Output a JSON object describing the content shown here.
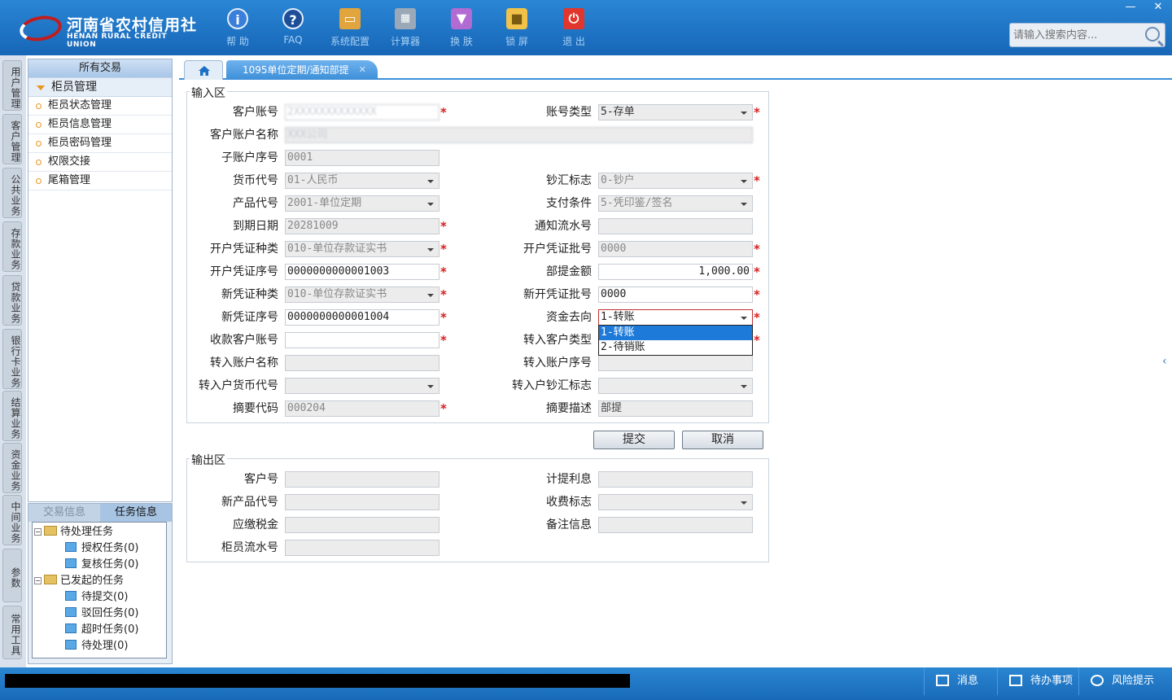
{
  "header": {
    "brand_cn": "河南省农村信用社",
    "brand_en": "HENAN RURAL CREDIT UNION",
    "buttons": [
      {
        "label": "帮 助",
        "icon": "info-icon"
      },
      {
        "label": "FAQ",
        "icon": "question-icon"
      },
      {
        "label": "系统配置",
        "icon": "toolbox-icon"
      },
      {
        "label": "计算器",
        "icon": "calculator-icon"
      },
      {
        "label": "换 肤",
        "icon": "shirt-icon"
      },
      {
        "label": "锁 屏",
        "icon": "lock-icon"
      },
      {
        "label": "退 出",
        "icon": "power-icon"
      }
    ],
    "window_controls": [
      "—",
      "✕"
    ],
    "search_placeholder": "请输入搜索内容..."
  },
  "vtabs": [
    "用户管理",
    "客户管理",
    "公共业务",
    "存款业务",
    "贷款业务",
    "银行卡业务",
    "结算业务",
    "资金业务",
    "中间业务",
    "参数",
    "常用工具"
  ],
  "nav": {
    "header": "所有交易",
    "group": "柜员管理",
    "items": [
      "柜员状态管理",
      "柜员信息管理",
      "柜员密码管理",
      "权限交接",
      "尾箱管理"
    ]
  },
  "task": {
    "tab_inactive": "交易信息",
    "tab_active": "任务信息",
    "tree": [
      {
        "label": "待处理任务",
        "type": "folder",
        "level": 0
      },
      {
        "label": "授权任务(0)",
        "type": "leaf",
        "level": 1
      },
      {
        "label": "复核任务(0)",
        "type": "leaf",
        "level": 1
      },
      {
        "label": "已发起的任务",
        "type": "folder",
        "level": 0
      },
      {
        "label": "待提交(0)",
        "type": "leaf",
        "level": 1
      },
      {
        "label": "驳回任务(0)",
        "type": "leaf",
        "level": 1
      },
      {
        "label": "超时任务(0)",
        "type": "leaf",
        "level": 1
      },
      {
        "label": "待处理(0)",
        "type": "leaf",
        "level": 1
      }
    ]
  },
  "tabs": {
    "active": "1095单位定期/通知部提",
    "close": "✕"
  },
  "input_section": {
    "title": "输入区",
    "fields": {
      "cust_account_label": "客户账号",
      "cust_account_value": "2XXXXXXXXXXXXX",
      "account_type_label": "账号类型",
      "account_type_value": "5-存单",
      "cust_name_label": "客户账户名称",
      "cust_name_value": "XXX公司",
      "sub_seq_label": "子账户序号",
      "sub_seq_value": "0001",
      "currency_label": "货币代号",
      "currency_value": "01-人民币",
      "cash_flag_label": "钞汇标志",
      "cash_flag_value": "0-钞户",
      "product_label": "产品代号",
      "product_value": "2001-单位定期",
      "pay_cond_label": "支付条件",
      "pay_cond_value": "5-凭印鉴/签名",
      "due_date_label": "到期日期",
      "due_date_value": "20281009",
      "notice_seq_label": "通知流水号",
      "notice_seq_value": "",
      "open_vtype_label": "开户凭证种类",
      "open_vtype_value": "010-单位存款证实书",
      "open_vbatch_label": "开户凭证批号",
      "open_vbatch_value": "0000",
      "open_vseq_label": "开户凭证序号",
      "open_vseq_value": "0000000000001003",
      "partial_amt_label": "部提金额",
      "partial_amt_value": "1,000.00",
      "new_vtype_label": "新凭证种类",
      "new_vtype_value": "010-单位存款证实书",
      "new_vbatch_label": "新开凭证批号",
      "new_vbatch_value": "0000",
      "new_vseq_label": "新凭证序号",
      "new_vseq_value": "0000000000001004",
      "fund_dir_label": "资金去向",
      "fund_dir_value": "1-转账",
      "recv_account_label": "收款客户账号",
      "recv_account_value": "",
      "in_cust_type_label": "转入客户类型",
      "in_name_label": "转入账户名称",
      "in_seq_label": "转入账户序号",
      "in_currency_label": "转入户货币代号",
      "in_cash_label": "转入户钞汇标志",
      "summary_code_label": "摘要代码",
      "summary_code_value": "000204",
      "summary_desc_label": "摘要描述",
      "summary_desc_value": "部提"
    },
    "dropdown_options": [
      "1-转账",
      "2-待销账"
    ],
    "required_mark": "*"
  },
  "buttons": {
    "submit": "提交",
    "cancel": "取消"
  },
  "output_section": {
    "title": "输出区",
    "cust_no_label": "客户号",
    "accr_int_label": "计提利息",
    "new_prod_label": "新产品代号",
    "fee_flag_label": "收费标志",
    "tax_label": "应缴税金",
    "remark_label": "备注信息",
    "teller_seq_label": "柜员流水号"
  },
  "statusbar": {
    "items": [
      "消息",
      "待办事项",
      "风险提示"
    ]
  },
  "colors": {
    "header_blue": "#1a6cbb",
    "accent": "#3d8fd8",
    "required": "#d61f1f"
  }
}
